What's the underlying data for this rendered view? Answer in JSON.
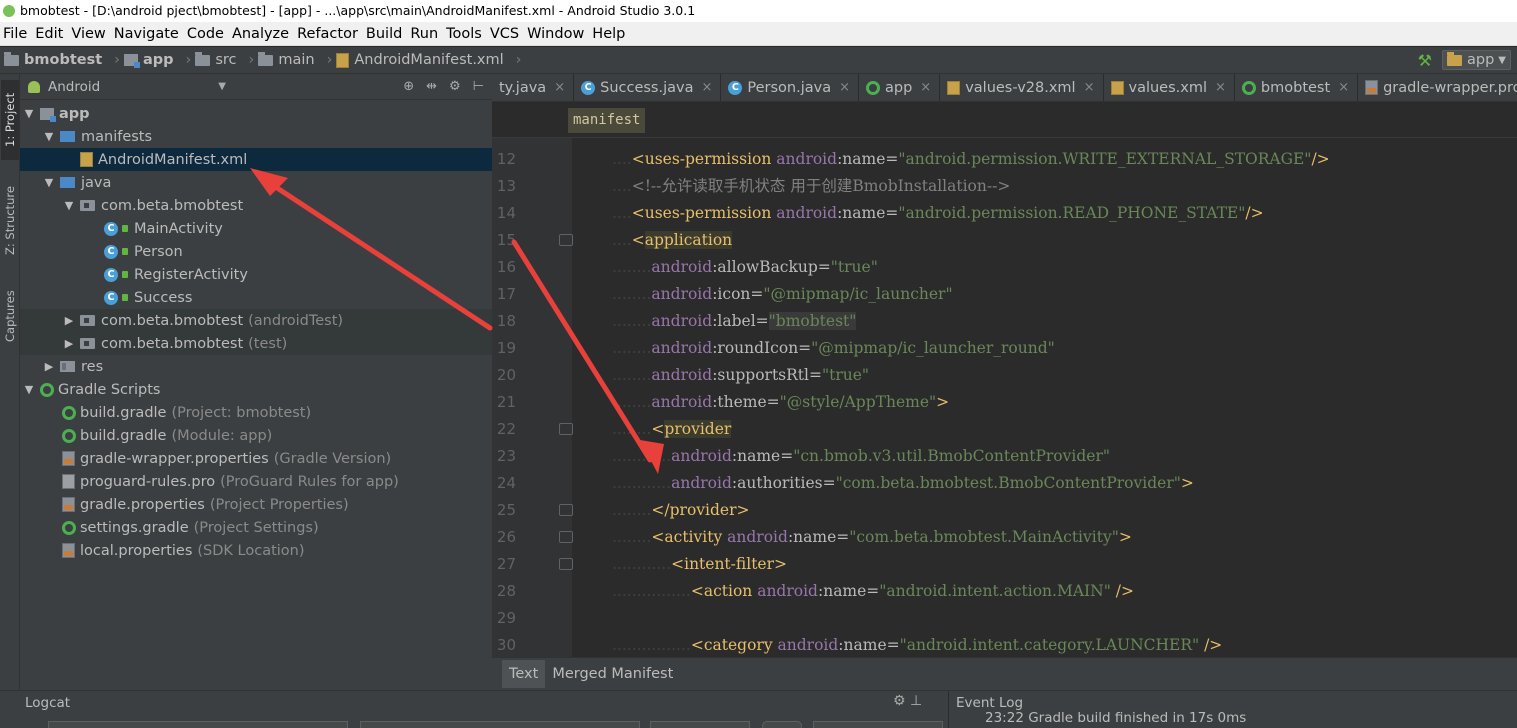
{
  "window": {
    "title": "bmobtest - [D:\\android pject\\bmobtest] - [app] - ...\\app\\src\\main\\AndroidManifest.xml - Android Studio 3.0.1"
  },
  "menu": [
    "File",
    "Edit",
    "View",
    "Navigate",
    "Code",
    "Analyze",
    "Refactor",
    "Build",
    "Run",
    "Tools",
    "VCS",
    "Window",
    "Help"
  ],
  "navbar": {
    "crumbs": [
      "bmobtest",
      "app",
      "src",
      "main",
      "AndroidManifest.xml"
    ],
    "run_config": "app"
  },
  "sidestripe": {
    "project": "1: Project",
    "structure": "Z: Structure",
    "captures": "Captures"
  },
  "project_panel": {
    "view": "Android",
    "items": [
      {
        "label": "app",
        "muted": ""
      },
      {
        "label": "manifests",
        "muted": ""
      },
      {
        "label": "AndroidManifest.xml",
        "muted": ""
      },
      {
        "label": "java",
        "muted": ""
      },
      {
        "label": "com.beta.bmobtest",
        "muted": ""
      },
      {
        "label": "MainActivity",
        "muted": ""
      },
      {
        "label": "Person",
        "muted": ""
      },
      {
        "label": "RegisterActivity",
        "muted": ""
      },
      {
        "label": "Success",
        "muted": ""
      },
      {
        "label": "com.beta.bmobtest",
        "muted": "(androidTest)"
      },
      {
        "label": "com.beta.bmobtest",
        "muted": "(test)"
      },
      {
        "label": "res",
        "muted": ""
      },
      {
        "label": "Gradle Scripts",
        "muted": ""
      },
      {
        "label": "build.gradle",
        "muted": "(Project: bmobtest)"
      },
      {
        "label": "build.gradle",
        "muted": "(Module: app)"
      },
      {
        "label": "gradle-wrapper.properties",
        "muted": "(Gradle Version)"
      },
      {
        "label": "proguard-rules.pro",
        "muted": "(ProGuard Rules for app)"
      },
      {
        "label": "gradle.properties",
        "muted": "(Project Properties)"
      },
      {
        "label": "settings.gradle",
        "muted": "(Project Settings)"
      },
      {
        "label": "local.properties",
        "muted": "(SDK Location)"
      }
    ]
  },
  "editor_tabs": [
    "ty.java",
    "Success.java",
    "Person.java",
    "app",
    "values-v28.xml",
    "values.xml",
    "bmobtest",
    "gradle-wrapper.properties"
  ],
  "tag_breadcrumb": "manifest",
  "code_lines": {
    "n12": "12",
    "n13": "13",
    "n14": "14",
    "n15": "15",
    "n16": "16",
    "n17": "17",
    "n18": "18",
    "n19": "19",
    "n20": "20",
    "n21": "21",
    "n22": "22",
    "n23": "23",
    "n24": "24",
    "n25": "25",
    "n26": "26",
    "n27": "27",
    "n28": "28",
    "n29": "29",
    "n30": "30",
    "l12_tag": "<uses-permission",
    "l12_attr": "android",
    "l12_name": ":name=",
    "l12_val": "\"android.permission.WRITE_EXTERNAL_STORAGE\"",
    "l12_end": "/>",
    "l13_comment": "<!--允许读取手机状态 用于创建BmobInstallation-->",
    "l14_tag": "<uses-permission",
    "l14_attr": "android",
    "l14_name": ":name=",
    "l14_val": "\"android.permission.READ_PHONE_STATE\"",
    "l14_end": "/>",
    "l15_lt": "<",
    "l15_tag": "application",
    "l16_attr": "android",
    "l16_name": ":allowBackup=",
    "l16_val": "\"true\"",
    "l17_attr": "android",
    "l17_name": ":icon=",
    "l17_val": "\"@mipmap/ic_launcher\"",
    "l18_attr": "android",
    "l18_name": ":label=",
    "l18_val": "\"bmobtest\"",
    "l19_attr": "android",
    "l19_name": ":roundIcon=",
    "l19_val": "\"@mipmap/ic_launcher_round\"",
    "l20_attr": "android",
    "l20_name": ":supportsRtl=",
    "l20_val": "\"true\"",
    "l21_attr": "android",
    "l21_name": ":theme=",
    "l21_val": "\"@style/AppTheme\"",
    "l21_end": ">",
    "l22_lt": "<",
    "l22_tag": "provider",
    "l23_attr": "android",
    "l23_name": ":name=",
    "l23_val": "\"cn.bmob.v3.util.BmobContentProvider\"",
    "l24_attr": "android",
    "l24_name": ":authorities=",
    "l24_val": "\"com.beta.bmobtest.BmobContentProvider\"",
    "l24_end": ">",
    "l25_tag": "</provider>",
    "l26_tag": "<activity",
    "l26_attr": "android",
    "l26_name": ":name=",
    "l26_val": "\"com.beta.bmobtest.MainActivity\"",
    "l26_end": ">",
    "l27_tag": "<intent-filter>",
    "l28_tag": "<action",
    "l28_attr": "android",
    "l28_name": ":name=",
    "l28_val": "\"android.intent.action.MAIN\"",
    "l28_end": " />",
    "l30_tag": "<category",
    "l30_attr": "android",
    "l30_name": ":name=",
    "l30_val": "\"android.intent.category.LAUNCHER\"",
    "l30_end": " />"
  },
  "bottom_tabs": [
    "Text",
    "Merged Manifest"
  ],
  "bottom_panel": {
    "logcat": "Logcat",
    "event_log": "Event Log",
    "event_msg": "23:22 Gradle build finished in 17s 0ms"
  },
  "colors": {
    "annotation_arrow": "#e8403a",
    "selection": "#0d293e",
    "tag": "#e8bf6a",
    "string": "#6a8759",
    "attribute": "#9876aa"
  }
}
